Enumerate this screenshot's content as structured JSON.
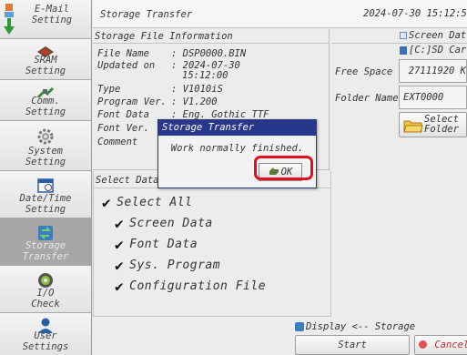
{
  "sidebar": {
    "items": [
      {
        "label": "E-Mail\nSetting",
        "icon": "email-download-icon"
      },
      {
        "label": "SRAM\nSetting",
        "icon": "sram-chip-icon"
      },
      {
        "label": "Comm.\nSetting",
        "icon": "comm-cable-icon"
      },
      {
        "label": "System\nSetting",
        "icon": "gear-icon"
      },
      {
        "label": "Date/Time\nSetting",
        "icon": "calendar-icon"
      },
      {
        "label": "Storage\nTransfer",
        "icon": "storage-transfer-icon",
        "active": true
      },
      {
        "label": "I/O\nCheck",
        "icon": "io-check-icon"
      },
      {
        "label": "User\nSettings",
        "icon": "user-icon"
      }
    ]
  },
  "header": {
    "title": "Storage Transfer",
    "datetime": "2024-07-30  15:12:5"
  },
  "file_info": {
    "heading": "Storage File Information",
    "rows": [
      {
        "label": "File Name",
        "value": ": DSP0000.BIN"
      },
      {
        "label": "Updated on",
        "value": ": 2024-07-30"
      },
      {
        "label": "",
        "value": "15:12:00"
      },
      {
        "label": "Type",
        "value": ": V1010iS"
      },
      {
        "label": "Program Ver.",
        "value": ": V1.200"
      },
      {
        "label": "Font Data",
        "value": ": Eng. Gothic TTF"
      },
      {
        "label": "Font Ver.",
        "value": ""
      },
      {
        "label": "Comment",
        "value": ""
      }
    ]
  },
  "storage": {
    "screen_data_label": "Screen Dat",
    "drive_label": "[C:]SD Car",
    "free_space_label": "Free Space",
    "free_space_value": "27111920 K",
    "folder_name_label": "Folder Name",
    "folder_name_value": "EXT0000",
    "select_folder_label": "Select\nFolder"
  },
  "select_data": {
    "heading": "Select Data",
    "items": [
      {
        "label": "Select All",
        "checked": true
      },
      {
        "label": "Screen Data",
        "checked": true
      },
      {
        "label": "Font Data",
        "checked": true
      },
      {
        "label": "Sys. Program",
        "checked": true
      },
      {
        "label": "Configuration File",
        "checked": true
      }
    ]
  },
  "transfer": {
    "direction_label": "Display <-- Storage",
    "start_label": "Start",
    "cancel_label": "Cancel"
  },
  "dialog": {
    "title": "Storage Transfer",
    "message": "Work normally finished.",
    "ok_label": "OK"
  },
  "colors": {
    "dialog_title_bg": "#27378c",
    "highlight": "#e0101a",
    "sidebar_active": "#a7a7a7"
  }
}
